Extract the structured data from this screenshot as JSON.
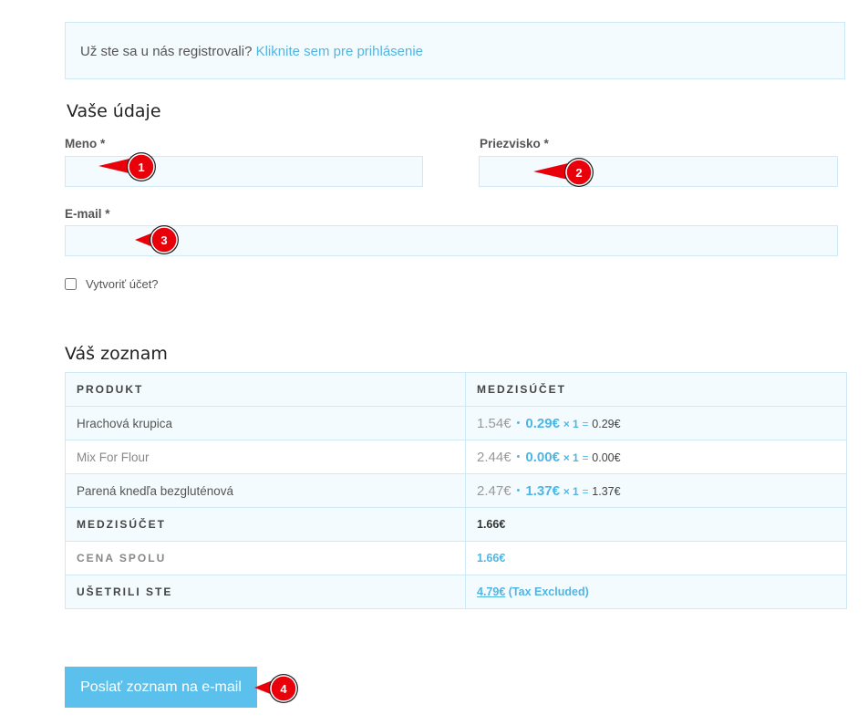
{
  "notice": {
    "text": "Už ste sa u nás registrovali?",
    "link": "Kliknite sem pre prihlásenie"
  },
  "details": {
    "heading": "Vaše údaje",
    "first_name_label": "Meno *",
    "last_name_label": "Priezvisko *",
    "email_label": "E-mail *",
    "create_account_label": "Vytvoriť účet?"
  },
  "list": {
    "heading": "Váš zoznam",
    "col_product": "PRODUKT",
    "col_subtotal": "MEDZISÚČET",
    "rows": [
      {
        "name": "Hrachová krupica",
        "old_price": "1.54€",
        "new_price": "0.29€",
        "qty": "× 1",
        "eq": "=",
        "result": "0.29€"
      },
      {
        "name": "Mix For Flour",
        "old_price": "2.44€",
        "new_price": "0.00€",
        "qty": "× 1",
        "eq": "=",
        "result": "0.00€"
      },
      {
        "name": "Parená knedľa bezgluténová",
        "old_price": "2.47€",
        "new_price": "1.37€",
        "qty": "× 1",
        "eq": "=",
        "result": "1.37€"
      }
    ],
    "subtotal_label": "MEDZISÚČET",
    "subtotal_value": "1.66€",
    "total_label": "CENA SPOLU",
    "total_value": "1.66€",
    "saved_label": "UŠETRILI STE",
    "saved_value": "4.79€",
    "saved_note": "(Tax Excluded)"
  },
  "send_button": "Poslať zoznam na e-mail",
  "markers": [
    "1",
    "2",
    "3",
    "4"
  ],
  "colors": {
    "accent": "#4fb6e3",
    "button": "#5bc0eb",
    "marker": "#e8000b"
  }
}
